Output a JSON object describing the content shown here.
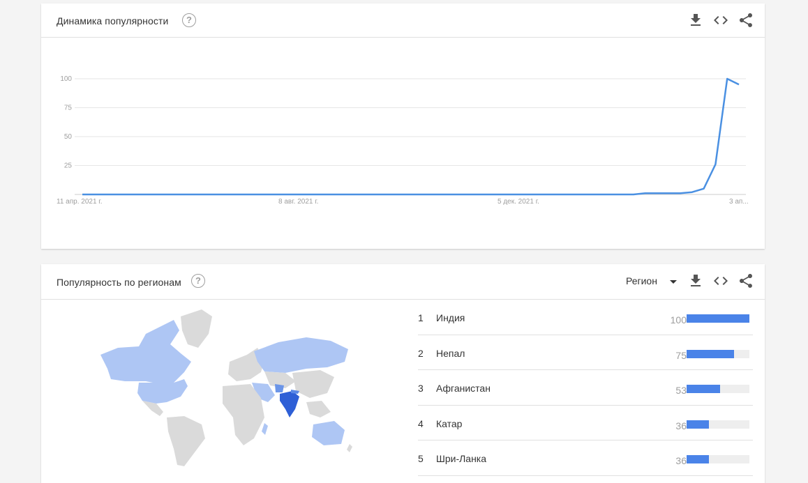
{
  "trend_card": {
    "title": "Динамика популярности",
    "help_icon": "help-circle-icon",
    "actions": [
      "download-icon",
      "embed-code-icon",
      "share-icon"
    ]
  },
  "chart_data": {
    "type": "line",
    "x_tick_labels": [
      "11 апр. 2021 г.",
      "8 авг. 2021 г.",
      "5 дек. 2021 г.",
      "3 ап..."
    ],
    "y_ticks": [
      25,
      50,
      75,
      100
    ],
    "ylim": [
      0,
      100
    ],
    "grid": true,
    "color": "#4a90e2",
    "series": [
      {
        "values": [
          0,
          0,
          0,
          0,
          0,
          0,
          0,
          0,
          0,
          0,
          0,
          0,
          0,
          0,
          0,
          0,
          0,
          0,
          0,
          0,
          0,
          0,
          0,
          0,
          0,
          0,
          0,
          0,
          0,
          0,
          0,
          0,
          0,
          0,
          0,
          0,
          0,
          0,
          0,
          0,
          0,
          0,
          0,
          0,
          0,
          0,
          0,
          0,
          1,
          1,
          1,
          1,
          2,
          5,
          26,
          100,
          95
        ]
      }
    ]
  },
  "region_card": {
    "title": "Популярность по регионам",
    "help_icon": "help-circle-icon",
    "region_select": "Регион",
    "actions": [
      "download-icon",
      "embed-code-icon",
      "share-icon"
    ],
    "rows": [
      {
        "rank": "1",
        "name": "Индия",
        "value": 100
      },
      {
        "rank": "2",
        "name": "Непал",
        "value": 75
      },
      {
        "rank": "3",
        "name": "Афганистан",
        "value": 53
      },
      {
        "rank": "4",
        "name": "Катар",
        "value": 36
      },
      {
        "rank": "5",
        "name": "Шри-Ланка",
        "value": 36
      }
    ],
    "map_colors": {
      "none": "#dadada",
      "low": "#aec6f4",
      "high": "#2e5fd6"
    }
  }
}
